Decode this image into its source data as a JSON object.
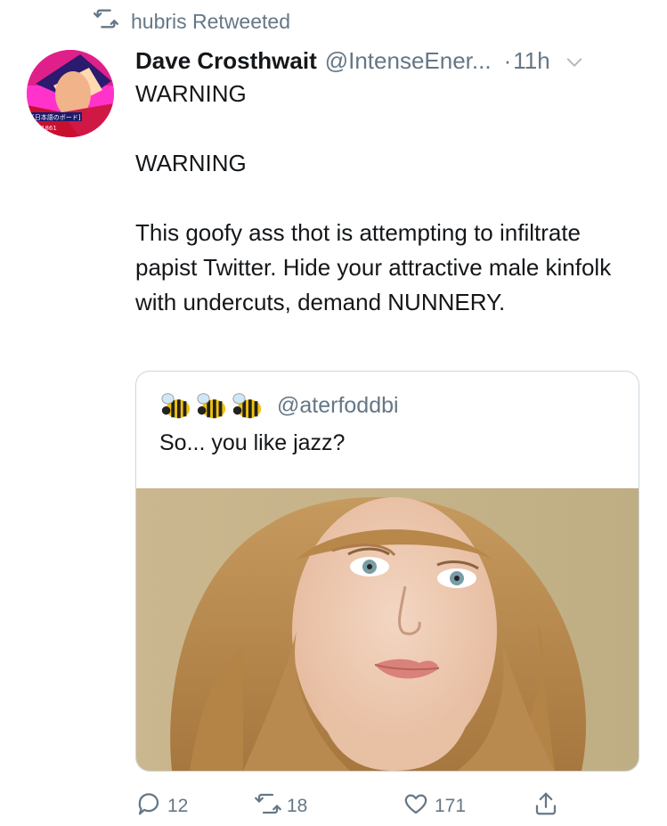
{
  "retweet": {
    "icon": "retweet-icon",
    "label": "hubris Retweeted"
  },
  "tweet": {
    "avatar_text": "[日本語のボード]",
    "avatar_year": "1861",
    "author_name": "Dave Crosthwait",
    "author_handle": "@IntenseEner...",
    "separator": "·",
    "timestamp": "11h",
    "body": {
      "line1": "WARNING",
      "line2": "WARNING",
      "paragraph": "This goofy ass thot is attempting to infiltrate papist Twitter. Hide your attractive male kinfolk with undercuts, demand NUNNERY."
    }
  },
  "quote": {
    "name_emoji": "🐝🐝🐝",
    "handle": "@aterfoddbi",
    "text": "So... you like jazz?"
  },
  "actions": {
    "reply_count": "12",
    "retweet_count": "18",
    "like_count": "171"
  },
  "colors": {
    "secondary_text": "#657786",
    "primary_text": "#14171a",
    "border": "#ccd6dd"
  }
}
